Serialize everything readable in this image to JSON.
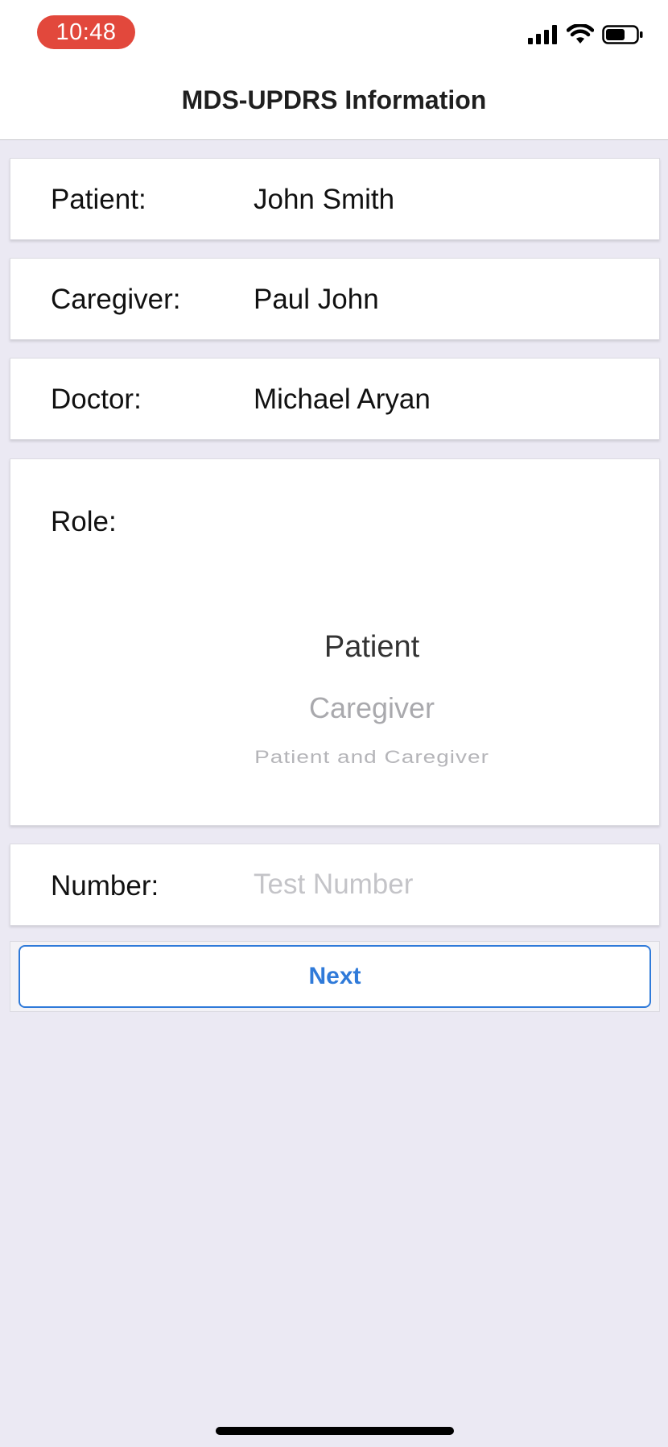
{
  "status_bar": {
    "time": "10:48",
    "time_pill_color": "#e2483c",
    "icons": [
      "signal-icon",
      "wifi-icon",
      "battery-icon"
    ]
  },
  "nav": {
    "title": "MDS-UPDRS Information"
  },
  "form": {
    "patient": {
      "label": "Patient:",
      "value": "John Smith"
    },
    "caregiver": {
      "label": "Caregiver:",
      "value": "Paul John"
    },
    "doctor": {
      "label": "Doctor:",
      "value": "Michael Aryan"
    },
    "role": {
      "label": "Role:",
      "options": [
        "Patient",
        "Caregiver",
        "Patient and Caregiver"
      ],
      "selected": "Patient"
    },
    "number": {
      "label": "Number:",
      "value": "",
      "placeholder": "Test Number"
    }
  },
  "actions": {
    "next_label": "Next"
  },
  "colors": {
    "accent": "#2f7ad9",
    "background": "#ebe9f3"
  }
}
